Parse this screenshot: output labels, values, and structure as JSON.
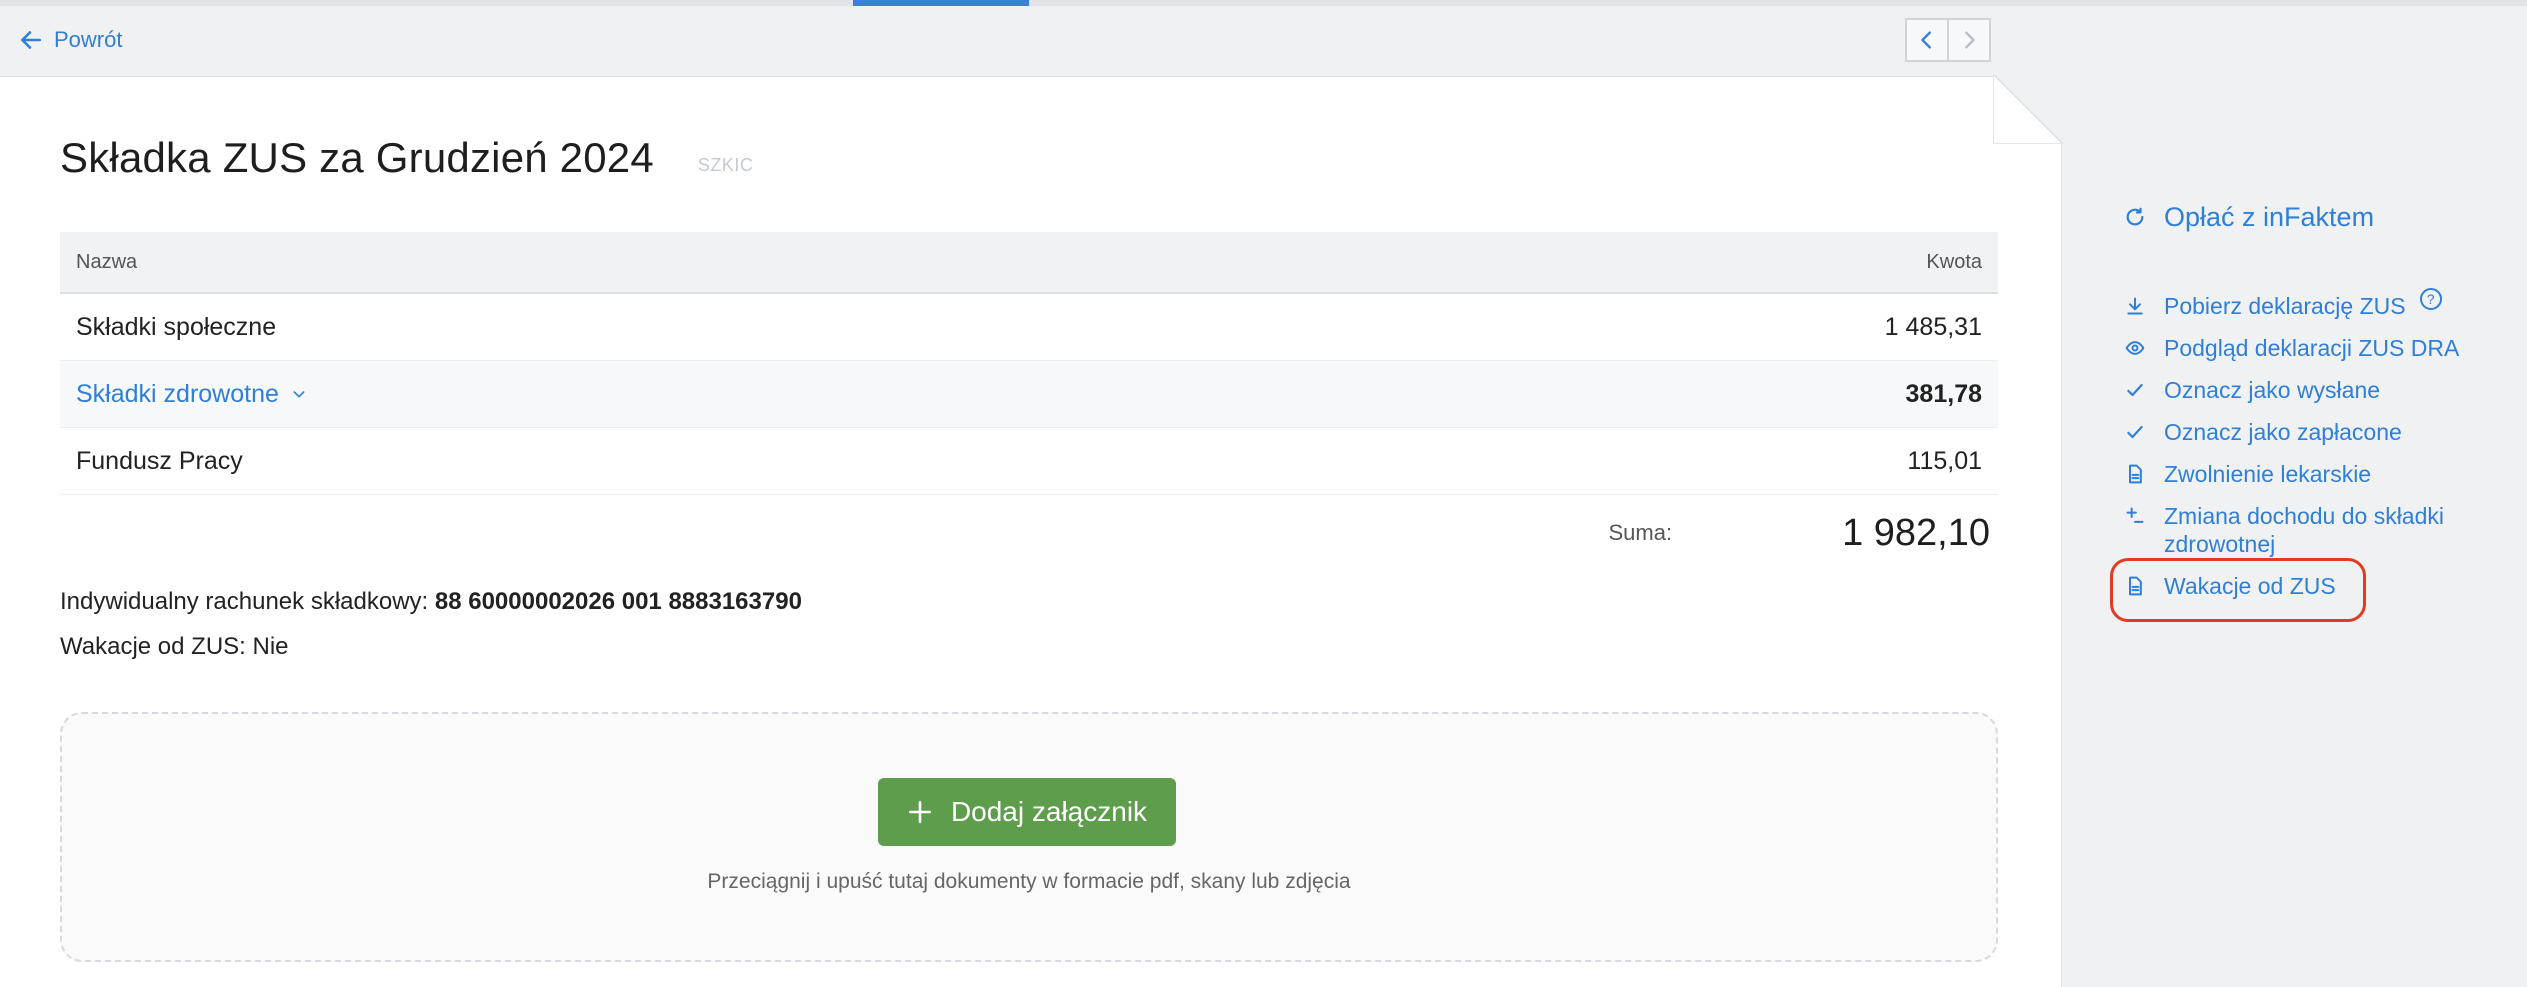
{
  "nav": {
    "back_label": "Powrót"
  },
  "document": {
    "title": "Składka ZUS za Grudzień 2024",
    "status_badge": "SZKIC",
    "table": {
      "headers": {
        "name": "Nazwa",
        "amount": "Kwota"
      },
      "rows": [
        {
          "name": "Składki społeczne",
          "amount": "1 485,31"
        },
        {
          "name": "Składki zdrowotne",
          "amount": "381,78"
        },
        {
          "name": "Fundusz Pracy",
          "amount": "115,01"
        }
      ],
      "sum_label": "Suma:",
      "sum_value": "1 982,10"
    },
    "account_label": "Indywidualny rachunek składkowy:",
    "account_number": "88 60000002026 001 8883163790",
    "vacation_text": "Wakacje od ZUS: Nie",
    "attachments": {
      "add_button_label": "Dodaj załącznik",
      "drop_hint": "Przeciągnij i upuść tutaj dokumenty w formacie pdf, skany lub zdjęcia"
    }
  },
  "sidebar": {
    "pay_label": "Opłać z inFaktem",
    "items": [
      {
        "label": "Pobierz deklarację ZUS",
        "icon": "download-icon"
      },
      {
        "label": "Podgląd deklaracji ZUS DRA",
        "icon": "eye-icon"
      },
      {
        "label": "Oznacz jako wysłane",
        "icon": "check-icon"
      },
      {
        "label": "Oznacz jako zapłacone",
        "icon": "check-icon"
      },
      {
        "label": "Zwolnienie lekarskie",
        "icon": "document-icon"
      },
      {
        "label": "Zmiana dochodu do składki zdrowotnej",
        "icon": "plus-minus-icon"
      },
      {
        "label": "Wakacje od ZUS",
        "icon": "document-icon"
      }
    ],
    "help_glyph": "?"
  },
  "colors": {
    "accent": "#2f7fd8",
    "primary_button": "#5d9d4b",
    "highlight": "#e03c25"
  }
}
